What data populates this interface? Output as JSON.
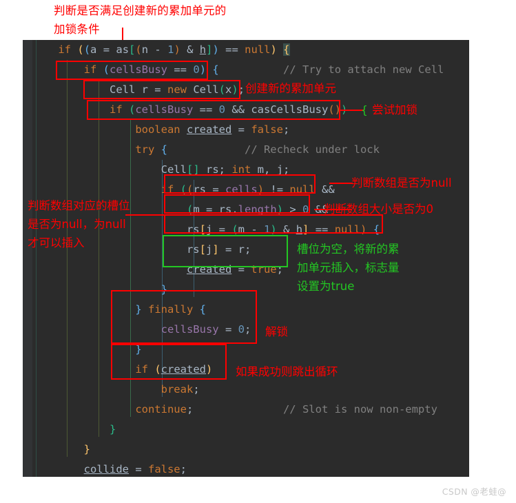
{
  "annotations": {
    "top_note": "判断是否满足创建新的累加单元的\n加锁条件",
    "create_cell": "创建新的累加单元",
    "try_lock": "尝试加锁",
    "try_lock_brace": "{",
    "check_array_null": "判断数组是否为null",
    "check_array_size": "判断数组大小是否为0",
    "check_slot_null": "判断数组对应的槽位\n是否为null，为null\n才可以插入",
    "slot_empty": "槽位为空，将新的累\n加单元插入，标志量\n设置为true",
    "unlock": "解锁",
    "break_loop": "如果成功则跳出循环"
  },
  "code": {
    "lines": [
      {
        "id": "line-1",
        "tokens": [
          {
            "t": "    ",
            "c": "plain"
          },
          {
            "t": "if",
            "c": "kw"
          },
          {
            "t": " ",
            "c": "plain"
          },
          {
            "t": "(",
            "c": "b1"
          },
          {
            "t": "(",
            "c": "b2"
          },
          {
            "t": "a",
            "c": "plain"
          },
          {
            "t": " = ",
            "c": "plain"
          },
          {
            "t": "as",
            "c": "plain"
          },
          {
            "t": "[",
            "c": "b3"
          },
          {
            "t": "(",
            "c": "b4"
          },
          {
            "t": "n",
            "c": "plain"
          },
          {
            "t": " ",
            "c": "plain"
          },
          {
            "t": "-",
            "c": "plain"
          },
          {
            "t": " ",
            "c": "plain"
          },
          {
            "t": "1",
            "c": "num"
          },
          {
            "t": ")",
            "c": "b4"
          },
          {
            "t": " & ",
            "c": "plain"
          },
          {
            "t": "h",
            "c": "plain und"
          },
          {
            "t": "]",
            "c": "b3"
          },
          {
            "t": ")",
            "c": "b2"
          },
          {
            "t": " == ",
            "c": "plain"
          },
          {
            "t": "null",
            "c": "kw"
          },
          {
            "t": ")",
            "c": "b1"
          },
          {
            "t": " ",
            "c": "plain"
          },
          {
            "t": "{",
            "c": "brace-hl"
          }
        ]
      },
      {
        "id": "line-2",
        "tokens": [
          {
            "t": "        ",
            "c": "plain"
          },
          {
            "t": "if",
            "c": "kw"
          },
          {
            "t": " ",
            "c": "plain"
          },
          {
            "t": "(",
            "c": "b2"
          },
          {
            "t": "cellsBusy",
            "c": "fld"
          },
          {
            "t": " == ",
            "c": "plain"
          },
          {
            "t": "0",
            "c": "num"
          },
          {
            "t": ")",
            "c": "b2"
          },
          {
            "t": " ",
            "c": "plain"
          },
          {
            "t": "{",
            "c": "b2"
          },
          {
            "t": "          ",
            "c": "plain"
          },
          {
            "t": "// Try to attach new Cell",
            "c": "cmt"
          }
        ]
      },
      {
        "id": "line-3",
        "tokens": [
          {
            "t": "            ",
            "c": "plain"
          },
          {
            "t": "Cell",
            "c": "typ"
          },
          {
            "t": " r = ",
            "c": "plain"
          },
          {
            "t": "new",
            "c": "kw"
          },
          {
            "t": " ",
            "c": "plain"
          },
          {
            "t": "Cell",
            "c": "typ"
          },
          {
            "t": "(",
            "c": "b3"
          },
          {
            "t": "x",
            "c": "plain"
          },
          {
            "t": ")",
            "c": "b3"
          },
          {
            "t": ";",
            "c": "plain"
          }
        ]
      },
      {
        "id": "line-4",
        "tokens": [
          {
            "t": "            ",
            "c": "plain"
          },
          {
            "t": "if",
            "c": "kw"
          },
          {
            "t": " ",
            "c": "plain"
          },
          {
            "t": "(",
            "c": "b3"
          },
          {
            "t": "cellsBusy",
            "c": "fld"
          },
          {
            "t": " == ",
            "c": "plain"
          },
          {
            "t": "0",
            "c": "num"
          },
          {
            "t": " && ",
            "c": "plain"
          },
          {
            "t": "casCellsBusy",
            "c": "meth"
          },
          {
            "t": "(",
            "c": "b4"
          },
          {
            "t": ")",
            "c": "b4"
          },
          {
            "t": ")",
            "c": "b3"
          }
        ]
      },
      {
        "id": "line-5",
        "tokens": [
          {
            "t": "                ",
            "c": "plain"
          },
          {
            "t": "boolean",
            "c": "kw"
          },
          {
            "t": " ",
            "c": "plain"
          },
          {
            "t": "created",
            "c": "plain und"
          },
          {
            "t": " = ",
            "c": "plain"
          },
          {
            "t": "false",
            "c": "kw"
          },
          {
            "t": ";",
            "c": "plain"
          }
        ]
      },
      {
        "id": "line-6",
        "tokens": [
          {
            "t": "                ",
            "c": "plain"
          },
          {
            "t": "try",
            "c": "kw"
          },
          {
            "t": " ",
            "c": "plain"
          },
          {
            "t": "{",
            "c": "b2"
          },
          {
            "t": "            ",
            "c": "plain"
          },
          {
            "t": "// Recheck under lock",
            "c": "cmt"
          }
        ]
      },
      {
        "id": "line-7",
        "tokens": [
          {
            "t": "                    ",
            "c": "plain"
          },
          {
            "t": "Cell",
            "c": "typ"
          },
          {
            "t": "[",
            "c": "b3"
          },
          {
            "t": "]",
            "c": "b3"
          },
          {
            "t": " rs; ",
            "c": "plain"
          },
          {
            "t": "int",
            "c": "kw"
          },
          {
            "t": " m, j;",
            "c": "plain"
          }
        ]
      },
      {
        "id": "line-8",
        "tokens": [
          {
            "t": "                    ",
            "c": "plain"
          },
          {
            "t": "if",
            "c": "kw"
          },
          {
            "t": " ",
            "c": "plain"
          },
          {
            "t": "(",
            "c": "b3"
          },
          {
            "t": "(",
            "c": "b4"
          },
          {
            "t": "rs",
            "c": "plain"
          },
          {
            "t": " = ",
            "c": "plain"
          },
          {
            "t": "cells",
            "c": "fld"
          },
          {
            "t": ")",
            "c": "b4"
          },
          {
            "t": " != ",
            "c": "plain"
          },
          {
            "t": "null",
            "c": "kw"
          },
          {
            "t": " && ",
            "c": "plain"
          }
        ]
      },
      {
        "id": "line-9",
        "tokens": [
          {
            "t": "                        ",
            "c": "plain"
          },
          {
            "t": "(",
            "c": "b3"
          },
          {
            "t": "m",
            "c": "plain"
          },
          {
            "t": " = ",
            "c": "plain"
          },
          {
            "t": "rs.",
            "c": "plain"
          },
          {
            "t": "length",
            "c": "fld"
          },
          {
            "t": ")",
            "c": "b3"
          },
          {
            "t": " > ",
            "c": "plain"
          },
          {
            "t": "0",
            "c": "num"
          },
          {
            "t": " &&",
            "c": "plain"
          }
        ]
      },
      {
        "id": "line-10",
        "tokens": [
          {
            "t": "                        ",
            "c": "plain"
          },
          {
            "t": "rs",
            "c": "plain"
          },
          {
            "t": "[",
            "c": "b1"
          },
          {
            "t": "j",
            "c": "plain"
          },
          {
            "t": " = ",
            "c": "plain"
          },
          {
            "t": "(",
            "c": "b3"
          },
          {
            "t": "m",
            "c": "plain"
          },
          {
            "t": " - ",
            "c": "plain"
          },
          {
            "t": "1",
            "c": "num"
          },
          {
            "t": ")",
            "c": "b3"
          },
          {
            "t": " & ",
            "c": "plain"
          },
          {
            "t": "h",
            "c": "plain und"
          },
          {
            "t": "]",
            "c": "b1"
          },
          {
            "t": " == ",
            "c": "plain"
          },
          {
            "t": "null",
            "c": "kw"
          },
          {
            "t": ")",
            "c": "b4"
          },
          {
            "t": " ",
            "c": "plain"
          },
          {
            "t": "{",
            "c": "b2"
          }
        ]
      },
      {
        "id": "line-11",
        "tokens": [
          {
            "t": "                        ",
            "c": "plain"
          },
          {
            "t": "rs",
            "c": "plain"
          },
          {
            "t": "[",
            "c": "b1"
          },
          {
            "t": "j",
            "c": "plain"
          },
          {
            "t": "]",
            "c": "b1"
          },
          {
            "t": " = r;",
            "c": "plain"
          }
        ]
      },
      {
        "id": "line-12",
        "tokens": [
          {
            "t": "                        ",
            "c": "plain"
          },
          {
            "t": "created",
            "c": "plain und"
          },
          {
            "t": " = ",
            "c": "plain"
          },
          {
            "t": "true",
            "c": "kw"
          },
          {
            "t": ";",
            "c": "plain"
          }
        ]
      },
      {
        "id": "line-13",
        "tokens": [
          {
            "t": "                    ",
            "c": "plain"
          },
          {
            "t": "}",
            "c": "b2"
          }
        ]
      },
      {
        "id": "line-14",
        "tokens": [
          {
            "t": "                ",
            "c": "plain"
          },
          {
            "t": "}",
            "c": "b2"
          },
          {
            "t": " ",
            "c": "plain"
          },
          {
            "t": "finally",
            "c": "kw"
          },
          {
            "t": " ",
            "c": "plain"
          },
          {
            "t": "{",
            "c": "b2"
          }
        ]
      },
      {
        "id": "line-15",
        "tokens": [
          {
            "t": "                    ",
            "c": "plain"
          },
          {
            "t": "cellsBusy",
            "c": "fld"
          },
          {
            "t": " = ",
            "c": "plain"
          },
          {
            "t": "0",
            "c": "num"
          },
          {
            "t": ";",
            "c": "plain"
          }
        ]
      },
      {
        "id": "line-16",
        "tokens": [
          {
            "t": "                ",
            "c": "plain"
          },
          {
            "t": "}",
            "c": "b2"
          }
        ]
      },
      {
        "id": "line-17",
        "tokens": [
          {
            "t": "                ",
            "c": "plain"
          },
          {
            "t": "if",
            "c": "kw"
          },
          {
            "t": " ",
            "c": "plain"
          },
          {
            "t": "(",
            "c": "b1"
          },
          {
            "t": "created",
            "c": "plain und"
          },
          {
            "t": ")",
            "c": "b1"
          }
        ]
      },
      {
        "id": "line-18",
        "tokens": [
          {
            "t": "                    ",
            "c": "plain"
          },
          {
            "t": "break",
            "c": "kw"
          },
          {
            "t": ";",
            "c": "plain"
          }
        ]
      },
      {
        "id": "line-19",
        "tokens": [
          {
            "t": "                ",
            "c": "plain"
          },
          {
            "t": "continue",
            "c": "kw"
          },
          {
            "t": ";",
            "c": "plain"
          },
          {
            "t": "              ",
            "c": "plain"
          },
          {
            "t": "// Slot is now non-empty",
            "c": "cmt"
          }
        ]
      },
      {
        "id": "line-20",
        "tokens": [
          {
            "t": "            ",
            "c": "plain"
          },
          {
            "t": "}",
            "c": "b3"
          }
        ]
      },
      {
        "id": "line-21",
        "tokens": [
          {
            "t": "        ",
            "c": "plain"
          },
          {
            "t": "}",
            "c": "b1"
          }
        ]
      },
      {
        "id": "line-22",
        "tokens": [
          {
            "t": "        ",
            "c": "plain"
          },
          {
            "t": "collide",
            "c": "plain und"
          },
          {
            "t": " = ",
            "c": "plain"
          },
          {
            "t": "false",
            "c": "kw"
          },
          {
            "t": ";",
            "c": "plain"
          }
        ]
      },
      {
        "id": "line-23",
        "tokens": [
          {
            "t": "    ",
            "c": "plain"
          },
          {
            "t": "}",
            "c": "brace-hl"
          }
        ]
      }
    ]
  },
  "watermark": "CSDN @老蛙@",
  "colors": {
    "editor_background": "#2b2b2b",
    "gutter": "#313335",
    "annotation_red": "#ff0000",
    "annotation_green": "#23c723",
    "keyword": "#cc7832",
    "field": "#9876aa",
    "number": "#6897bb",
    "comment": "#808080",
    "text": "#a9b7c6"
  }
}
